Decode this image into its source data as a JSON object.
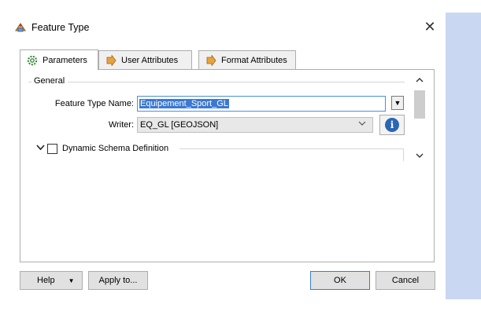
{
  "window": {
    "title": "Feature Type",
    "close_glyph": "✕",
    "icon": "feature-type-icon"
  },
  "tabs": [
    {
      "label": "Parameters",
      "icon": "gear-icon",
      "active": true
    },
    {
      "label": "User Attributes",
      "icon": "arrow-right-icon",
      "active": false
    },
    {
      "label": "Format Attributes",
      "icon": "arrow-right-icon",
      "active": false
    }
  ],
  "general": {
    "legend": "General",
    "feature_type_name_label": "Feature Type Name:",
    "feature_type_name_value": "Equipement_Sport_GL",
    "writer_label": "Writer:",
    "writer_value": "EQ_GL [GEOJSON]",
    "info_glyph": "i"
  },
  "dynamic_schema": {
    "label": "Dynamic Schema Definition",
    "checked": false
  },
  "buttons": {
    "help": "Help",
    "help_arrow": "▼",
    "apply_to": "Apply to...",
    "ok": "OK",
    "cancel": "Cancel"
  },
  "colors": {
    "accent": "#3a78d4",
    "side_strip": "#c9d7f2",
    "tab_arrow": "#e8a33d",
    "info": "#2b66b5"
  }
}
